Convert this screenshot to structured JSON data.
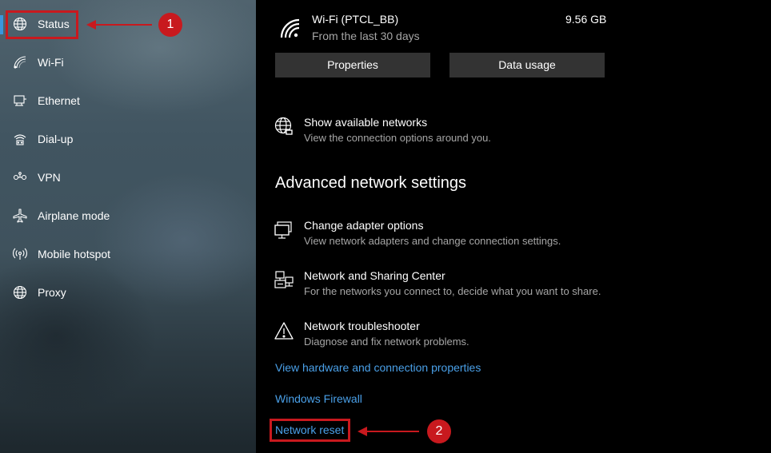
{
  "sidebar": {
    "items": [
      {
        "label": "Status",
        "icon": "globe-icon"
      },
      {
        "label": "Wi-Fi",
        "icon": "wifi-icon"
      },
      {
        "label": "Ethernet",
        "icon": "ethernet-icon"
      },
      {
        "label": "Dial-up",
        "icon": "dialup-icon"
      },
      {
        "label": "VPN",
        "icon": "vpn-icon"
      },
      {
        "label": "Airplane mode",
        "icon": "airplane-icon"
      },
      {
        "label": "Mobile hotspot",
        "icon": "hotspot-icon"
      },
      {
        "label": "Proxy",
        "icon": "globe-icon"
      }
    ],
    "active": "Status"
  },
  "connection": {
    "name": "Wi-Fi (PTCL_BB)",
    "subtitle": "From the last 30 days",
    "usage": "9.56 GB"
  },
  "buttons": {
    "properties": "Properties",
    "data_usage": "Data usage"
  },
  "show_networks": {
    "title": "Show available networks",
    "desc": "View the connection options around you."
  },
  "advanced": {
    "heading": "Advanced network settings",
    "items": [
      {
        "title": "Change adapter options",
        "desc": "View network adapters and change connection settings.",
        "icon": "adapter-icon"
      },
      {
        "title": "Network and Sharing Center",
        "desc": "For the networks you connect to, decide what you want to share.",
        "icon": "sharing-center-icon"
      },
      {
        "title": "Network troubleshooter",
        "desc": "Diagnose and fix network problems.",
        "icon": "warning-icon"
      }
    ]
  },
  "links": {
    "hardware": "View hardware and connection properties",
    "firewall": "Windows Firewall",
    "reset": "Network reset"
  },
  "annotations": {
    "step1": "1",
    "step2": "2",
    "color": "#c8191e"
  },
  "colors": {
    "accent": "#3a96dd",
    "link": "#4aa0e8",
    "button_bg": "#333333",
    "annotation": "#c8191e"
  }
}
